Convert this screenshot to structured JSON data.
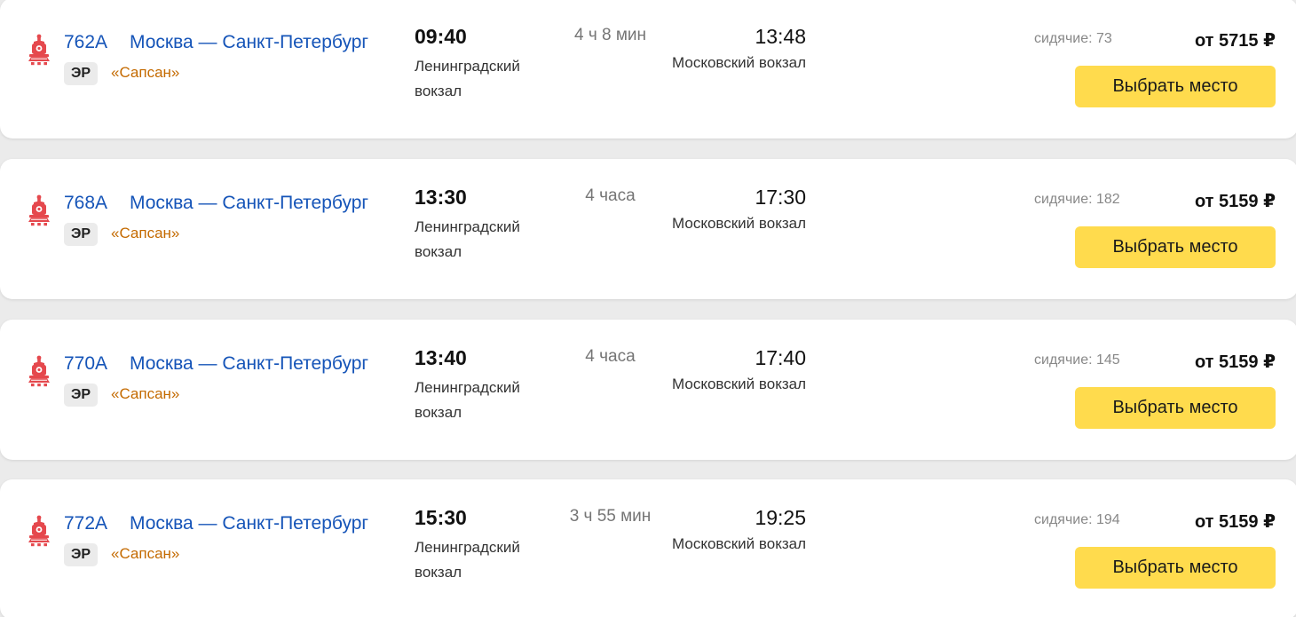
{
  "colors": {
    "link": "#1554b8",
    "brand": "#c46a00",
    "button": "#ffdb4d",
    "train_icon": "#e5484d"
  },
  "icons": {
    "train": "locomotive-icon"
  },
  "trains": [
    {
      "number": "762А",
      "route": "Москва — Санкт-Петербург",
      "badge": "ЭР",
      "brand": "«Сапсан»",
      "departure_time": "09:40",
      "departure_station": "Ленинградский вокзал",
      "duration": "4 ч 8 мин",
      "arrival_time": "13:48",
      "arrival_station": "Московский вокзал",
      "seats": "сидячие: 73",
      "price": "от 5715 ₽",
      "button_label": "Выбрать место"
    },
    {
      "number": "768А",
      "route": "Москва — Санкт-Петербург",
      "badge": "ЭР",
      "brand": "«Сапсан»",
      "departure_time": "13:30",
      "departure_station": "Ленинградский вокзал",
      "duration": "4 часа",
      "arrival_time": "17:30",
      "arrival_station": "Московский вокзал",
      "seats": "сидячие: 182",
      "price": "от 5159 ₽",
      "button_label": "Выбрать место"
    },
    {
      "number": "770А",
      "route": "Москва — Санкт-Петербург",
      "badge": "ЭР",
      "brand": "«Сапсан»",
      "departure_time": "13:40",
      "departure_station": "Ленинградский вокзал",
      "duration": "4 часа",
      "arrival_time": "17:40",
      "arrival_station": "Московский вокзал",
      "seats": "сидячие: 145",
      "price": "от 5159 ₽",
      "button_label": "Выбрать место"
    },
    {
      "number": "772А",
      "route": "Москва — Санкт-Петербург",
      "badge": "ЭР",
      "brand": "«Сапсан»",
      "departure_time": "15:30",
      "departure_station": "Ленинградский вокзал",
      "duration": "3 ч 55 мин",
      "arrival_time": "19:25",
      "arrival_station": "Московский вокзал",
      "seats": "сидячие: 194",
      "price": "от 5159 ₽",
      "button_label": "Выбрать место"
    }
  ]
}
